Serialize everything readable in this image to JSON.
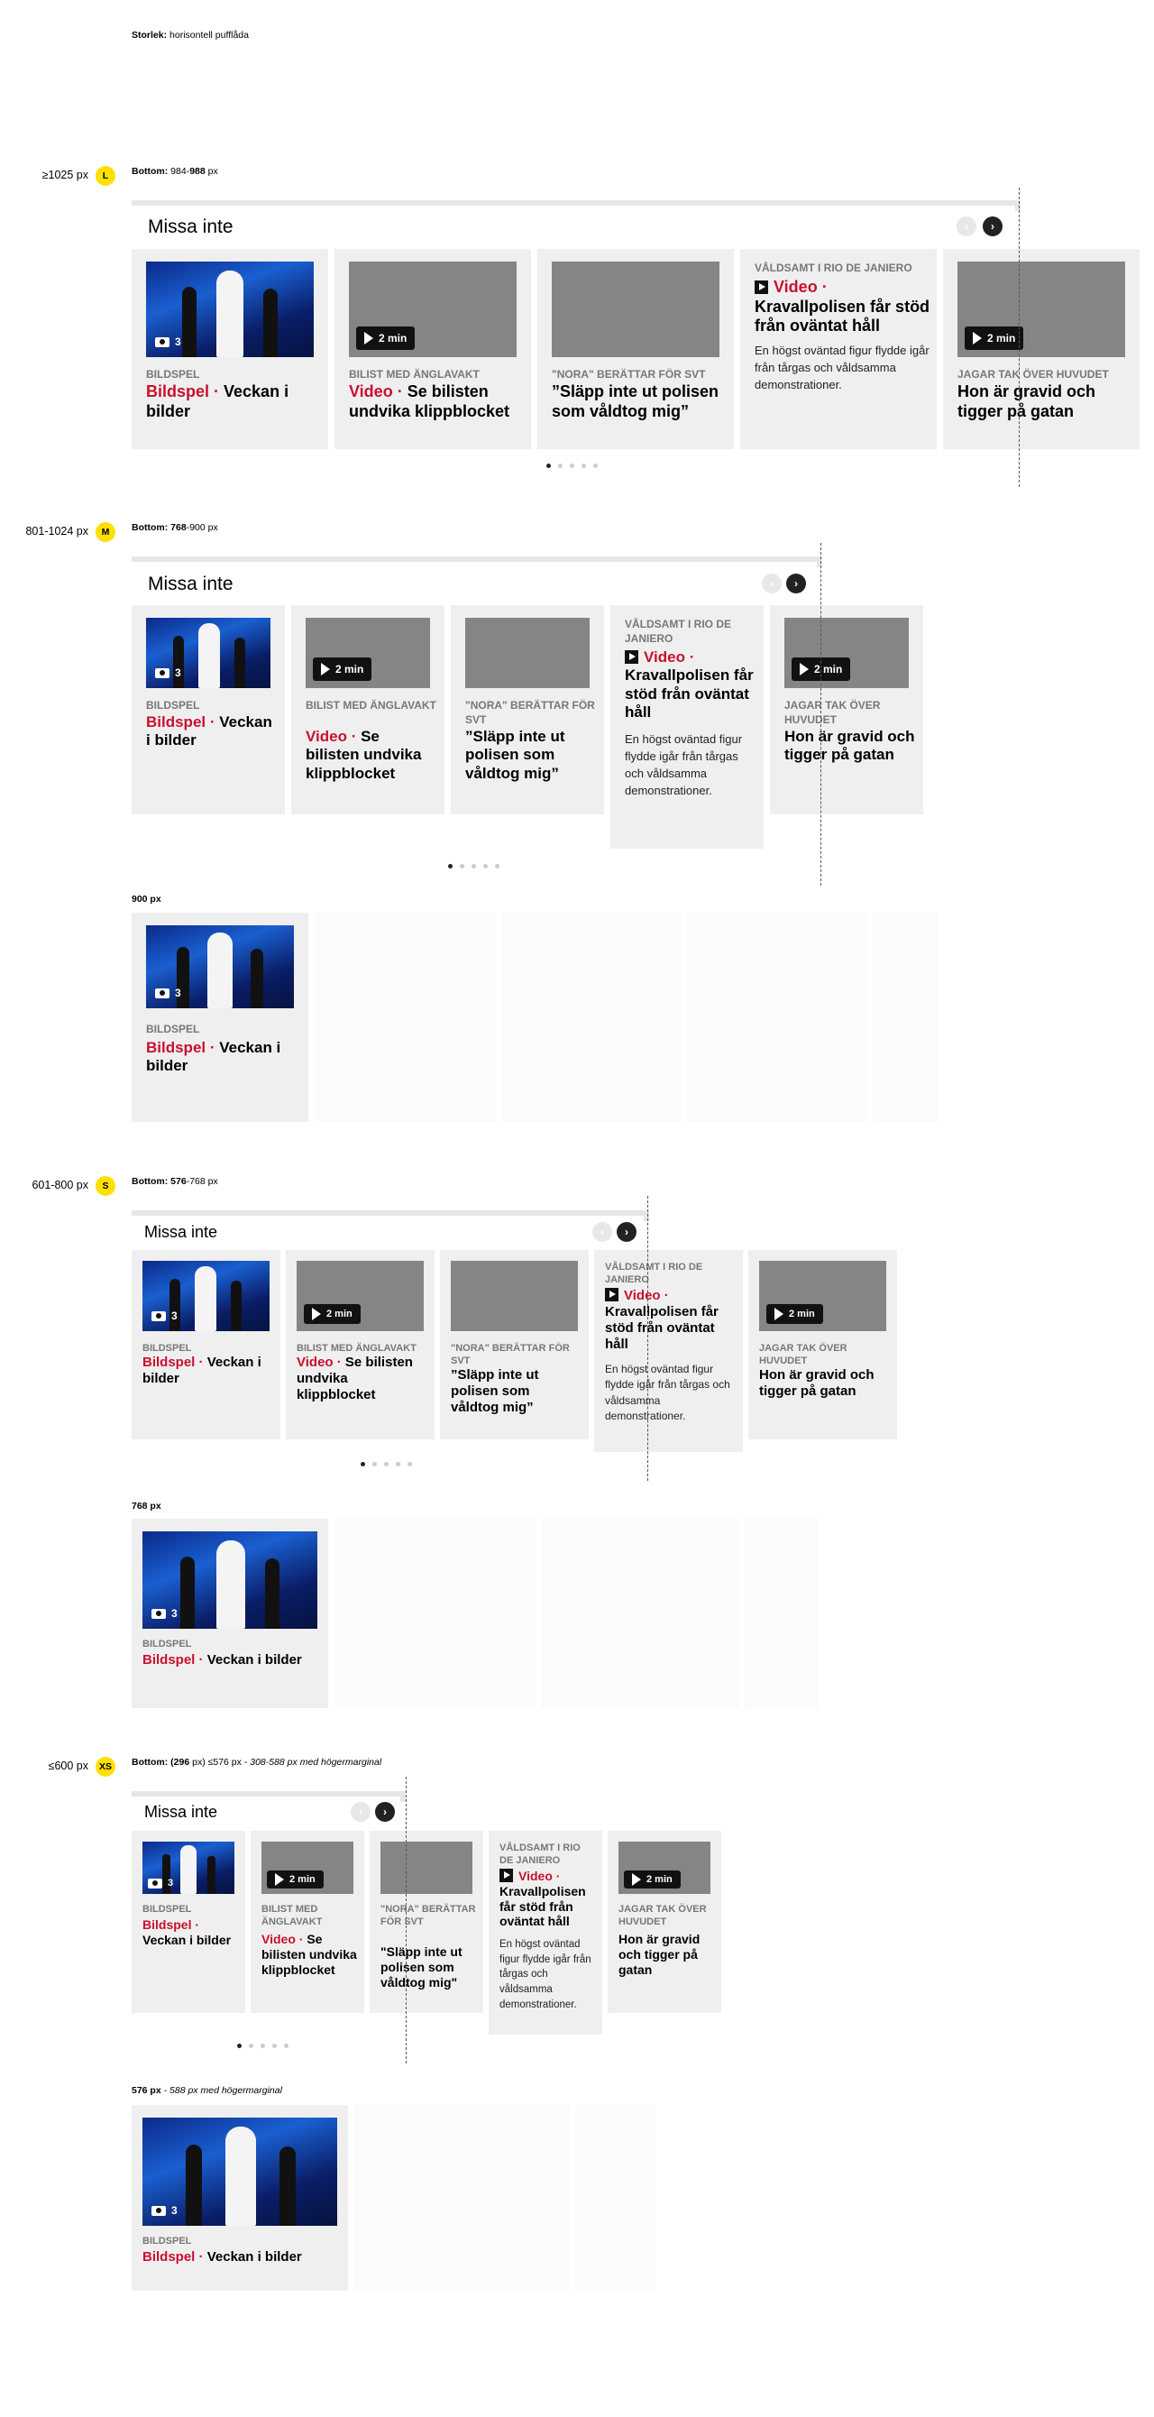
{
  "header": {
    "label": "Storlek:",
    "value": "horisontell pufflåda"
  },
  "sections": {
    "L": {
      "range": "≥1025 px",
      "badge": "L",
      "note_label": "Bottom:",
      "note_a": "984-",
      "note_b": "988",
      "note_c": " px"
    },
    "M": {
      "range": "801-1024 px",
      "badge": "M",
      "note_label": "Bottom:",
      "note_a": "768",
      "note_b": "-900 px",
      "sub": "900 px"
    },
    "S": {
      "range": "601-800 px",
      "badge": "S",
      "note_label": "Bottom:",
      "note_a": "576",
      "note_b": "-768 px",
      "sub": "768 px"
    },
    "XS": {
      "range": "≤600 px",
      "badge": "XS",
      "note_label": "Bottom:",
      "note_a": "(296",
      "note_b": " px) ≤576 px - ",
      "note_c": "308-588 px med högermarginal",
      "sub_a": "576 px",
      "sub_b": " - 588 px med högermarginal"
    }
  },
  "module": {
    "heading": "Missa inte",
    "prev_icon": "chevron-left-icon",
    "next_icon": "chevron-right-icon"
  },
  "cards": {
    "c1": {
      "kicker": "Bildspel",
      "label": "Bildspel",
      "sep": " · ",
      "title": "Veckan i bilder",
      "count": "3",
      "icon": "camera-icon"
    },
    "c2": {
      "kicker": "Bilist med änglavakt",
      "label": "Video",
      "sep": " · ",
      "title": "Se bilisten undvika klippblocket",
      "duration": "2 min",
      "icon": "play-icon"
    },
    "c3": {
      "kicker": "\"Nora\" berättar för SVT",
      "title": "”Släpp inte ut polisen som våldtog mig”",
      "title_xs": "\"Släpp inte ut polisen som våldtog mig\""
    },
    "c4": {
      "kicker": "Våldsamt i Rio de Janiero",
      "label": "Video",
      "sep": " · ",
      "title": "Kravallpolisen får stöd från oväntat håll",
      "desc": "En högst oväntad figur flydde igår från tårgas och våldsamma demonstrationer."
    },
    "c5": {
      "kicker": "Jagar tak över huvudet",
      "title": "Hon är gravid och tigger på gatan",
      "duration": "2 min"
    }
  },
  "colors": {
    "accent_red": "#c8102e",
    "badge_yellow": "#ffe000",
    "card_bg": "#efefef",
    "thumb_gray": "#858585"
  }
}
